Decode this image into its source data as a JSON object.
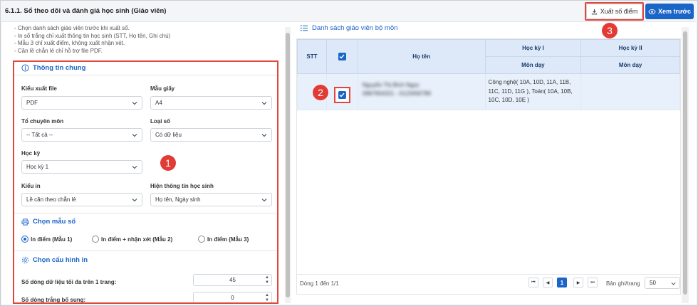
{
  "page": {
    "title": "6.1.1. Sổ theo dõi và đánh giá học sinh (Giáo viên)"
  },
  "toolbar": {
    "export_label": "Xuất số điểm",
    "preview_label": "Xem trước"
  },
  "badges": [
    "1",
    "2",
    "3"
  ],
  "notes": [
    "Chọn danh sách giáo viên trước khi xuất sổ.",
    "In sổ trắng chỉ xuất thông tin học sinh (STT, Họ tên, Ghi chú)",
    "Mẫu 3 chỉ xuất điểm, không xuất nhận xét.",
    "Căn lề chẵn lẻ chỉ hỗ trợ file PDF."
  ],
  "general": {
    "title": "Thông tin chung",
    "file_type": {
      "label": "Kiểu xuất file",
      "value": "PDF"
    },
    "paper": {
      "label": "Mẫu giấy",
      "value": "A4"
    },
    "department": {
      "label": "Tổ chuyên môn",
      "value": "-- Tất cả --"
    },
    "book_type": {
      "label": "Loại số",
      "value": "Có dữ liệu"
    },
    "semester": {
      "label": "Học kỳ",
      "value": "Học kỳ 1"
    },
    "print_type": {
      "label": "Kiểu in",
      "value": "Lề căn theo chẵn lẻ"
    },
    "student_info": {
      "label": "Hiện thông tin học sinh",
      "value": "Họ tên, Ngày sinh"
    }
  },
  "template": {
    "title": "Chọn mẫu sổ",
    "options": [
      {
        "label": "In điểm (Mẫu 1)",
        "checked": true
      },
      {
        "label": "In điểm + nhận xét (Mẫu 2)",
        "checked": false
      },
      {
        "label": "In điểm (Mẫu 3)",
        "checked": false
      }
    ]
  },
  "config": {
    "title": "Chọn cấu hình in",
    "max_rows": {
      "label": "Số dòng dữ liệu tối đa trên 1 trang:",
      "value": "45"
    },
    "blank_rows": {
      "label": "Số dòng trắng bổ sung:",
      "value": "0"
    }
  },
  "teacher_list": {
    "title": "Danh sách giáo viên bộ môn",
    "columns": {
      "stt": "STT",
      "name": "Họ tên",
      "sem1": "Học kỳ I",
      "sem2": "Học kỳ II",
      "subject1": "Môn dạy",
      "subject2": "Môn dạy"
    },
    "rows": [
      {
        "name_line1": "Nguyễn Thị Bích Ngọc",
        "name_line2": "0987654321 - 0123456789",
        "sem1_subjects": "Công nghệ( 10A, 10D, 11A, 11B, 11C, 11D, 11G ), Toán( 10A, 10B, 10C, 10D, 10E )",
        "sem2_subjects": ""
      }
    ]
  },
  "pager": {
    "info": "Dòng 1 đến 1/1",
    "current_page": "1",
    "per_page_label": "Bản ghi/trang",
    "per_page_value": "50"
  },
  "colors": {
    "accent": "#1b64c8",
    "highlight": "#e0463b",
    "header_bg": "#dde9f8"
  }
}
